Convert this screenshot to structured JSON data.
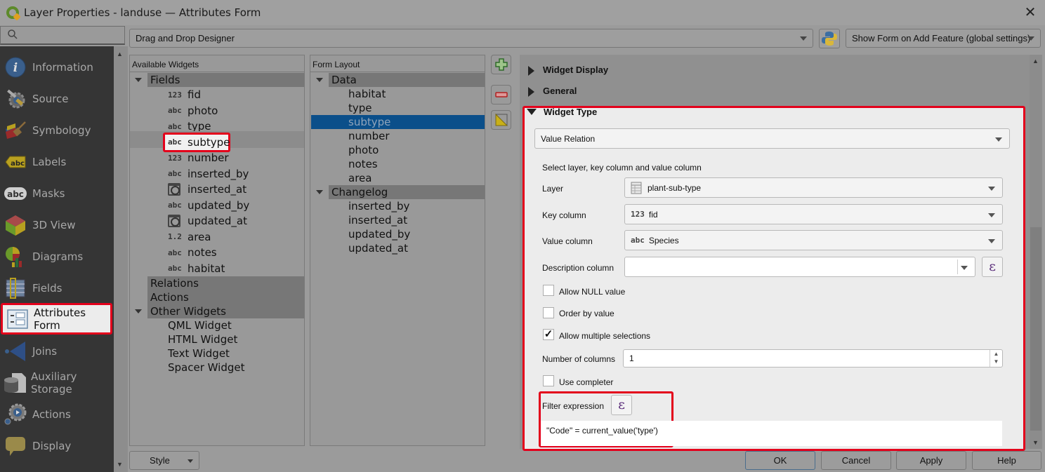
{
  "window": {
    "title": "Layer Properties - landuse — Attributes Form",
    "close_label": "✕"
  },
  "search": {
    "placeholder": ""
  },
  "sidebar": {
    "items": [
      {
        "label": "Information",
        "icon": "information-icon"
      },
      {
        "label": "Source",
        "icon": "source-icon"
      },
      {
        "label": "Symbology",
        "icon": "symbology-icon"
      },
      {
        "label": "Labels",
        "icon": "labels-icon"
      },
      {
        "label": "Masks",
        "icon": "masks-icon"
      },
      {
        "label": "3D View",
        "icon": "3d-view-icon"
      },
      {
        "label": "Diagrams",
        "icon": "diagrams-icon"
      },
      {
        "label": "Fields",
        "icon": "fields-icon"
      },
      {
        "label": "Attributes Form",
        "icon": "attributes-form-icon",
        "active": true
      },
      {
        "label": "Joins",
        "icon": "joins-icon"
      },
      {
        "label": "Auxiliary Storage",
        "icon": "auxiliary-storage-icon"
      },
      {
        "label": "Actions",
        "icon": "actions-icon"
      },
      {
        "label": "Display",
        "icon": "display-icon"
      }
    ]
  },
  "toolbar": {
    "designer_mode": "Drag and Drop Designer",
    "python_button": "python-init-code",
    "show_form": "Show Form on Add Feature (global settings)"
  },
  "available_widgets": {
    "header": "Available Widgets",
    "fields_group": "Fields",
    "fields": [
      {
        "badge": "123",
        "name": "fid"
      },
      {
        "badge": "abc",
        "name": "photo"
      },
      {
        "badge": "abc",
        "name": "type"
      },
      {
        "badge": "abc",
        "name": "subtype",
        "highlighted": true
      },
      {
        "badge": "123",
        "name": "number"
      },
      {
        "badge": "abc",
        "name": "inserted_by"
      },
      {
        "badge": "datetime",
        "name": "inserted_at"
      },
      {
        "badge": "abc",
        "name": "updated_by"
      },
      {
        "badge": "datetime",
        "name": "updated_at"
      },
      {
        "badge": "1.2",
        "name": "area"
      },
      {
        "badge": "abc",
        "name": "notes"
      },
      {
        "badge": "abc",
        "name": "habitat"
      }
    ],
    "relations_group": "Relations",
    "actions_group": "Actions",
    "other_group": "Other Widgets",
    "other_widgets": [
      "QML Widget",
      "HTML Widget",
      "Text Widget",
      "Spacer Widget"
    ]
  },
  "form_layout": {
    "header": "Form Layout",
    "groups": [
      {
        "name": "Data",
        "items": [
          "habitat",
          "type",
          "subtype",
          "number",
          "photo",
          "notes",
          "area"
        ]
      },
      {
        "name": "Changelog",
        "items": [
          "inserted_by",
          "inserted_at",
          "updated_by",
          "updated_at"
        ]
      }
    ],
    "selected": "subtype"
  },
  "properties": {
    "widget_display": "Widget Display",
    "general": "General",
    "widget_type": "Widget Type",
    "widget_type_value": "Value Relation",
    "select_hint": "Select layer, key column and value column",
    "layer_label": "Layer",
    "layer_value": "plant-sub-type",
    "key_label": "Key column",
    "key_badge": "123",
    "key_value": "fid",
    "value_label": "Value column",
    "value_badge": "abc",
    "value_value": "Species",
    "description_label": "Description column",
    "description_value": "",
    "allow_null_label": "Allow NULL value",
    "allow_null": false,
    "order_by_value_label": "Order by value",
    "order_by_value": false,
    "allow_multiple_label": "Allow multiple selections",
    "allow_multiple": true,
    "num_columns_label": "Number of columns",
    "num_columns_value": "1",
    "use_completer_label": "Use completer",
    "use_completer": false,
    "filter_label": "Filter expression",
    "filter_value": "\"Code\" = current_value('type')",
    "expression_glyph": "ε"
  },
  "footer": {
    "style": "Style",
    "ok": "OK",
    "cancel": "Cancel",
    "apply": "Apply",
    "help": "Help"
  },
  "colors": {
    "highlight": "#e3001b",
    "selection": "#0b4f8a"
  }
}
